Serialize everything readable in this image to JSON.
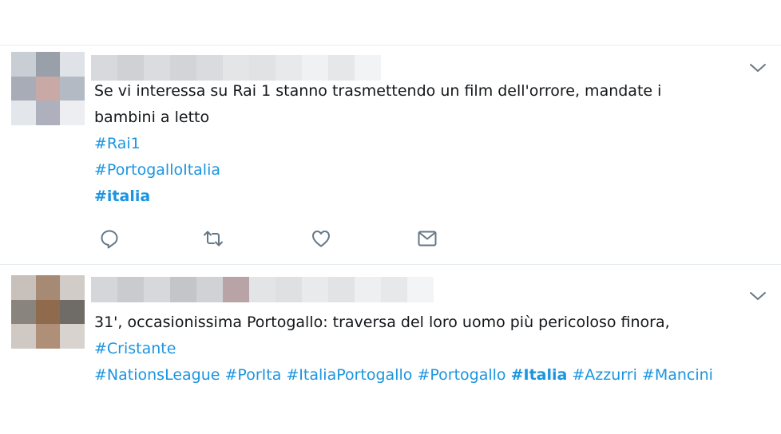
{
  "tweets": [
    {
      "id": "tweet-1",
      "text_lines": [
        "Se vi interessa su Rai 1 stanno trasmettendo un film dell'orrore, mandate i",
        "bambini a letto"
      ],
      "hashtags": [
        "#Rai1",
        "#PortogalloItalia",
        "#italia"
      ],
      "actions": [
        "reply-icon",
        "retweet-icon",
        "like-icon",
        "message-icon"
      ]
    },
    {
      "id": "tweet-2",
      "text_lines": [
        "31', occasionissima Portogallo: traversa del loro uomo più pericoloso finora,"
      ],
      "hashtag_line1": "#Cristante",
      "hashtag_line2": [
        "#NationsLeague",
        "#PorIta",
        "#ItaliaPortogallo",
        "#Portogallo",
        "#Italia",
        "#Azzurri",
        "#Mancini"
      ]
    }
  ],
  "colors": {
    "link": "#1b95e0",
    "text": "#14171a",
    "icon": "#657786",
    "divider": "#e6ecf0"
  }
}
